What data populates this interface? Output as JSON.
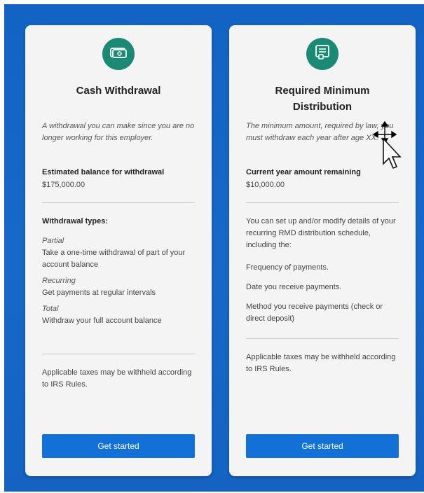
{
  "cards": [
    {
      "icon": "cash-icon",
      "title": "Cash Withdrawal",
      "description": "A withdrawal you can make since you are no longer working for this employer.",
      "amount_label": "Estimated balance for withdrawal",
      "amount_value": "$175,000.00",
      "section_title": "Withdrawal types:",
      "types": [
        {
          "name": "Partial",
          "desc": "Take a one-time withdrawal of part of your account balance"
        },
        {
          "name": "Recurring",
          "desc": "Get payments at regular intervals"
        },
        {
          "name": "Total",
          "desc": "Withdraw your full account balance"
        }
      ],
      "note": "Applicable taxes may be withheld according to IRS Rules.",
      "button": "Get started"
    },
    {
      "icon": "document-icon",
      "title_line1": "Required Minimum",
      "title_line2": "Distribution",
      "description": "The minimum amount, required by law, you must withdraw each year after age XX.",
      "amount_label": "Current year amount remaining",
      "amount_value": "$10,000.00",
      "intro": "You can set up and/or modify details of your recurring RMD distribution schedule, including the:",
      "items": [
        "Frequency of payments.",
        "Date you receive payments.",
        "Method you receive payments (check or direct deposit)"
      ],
      "note": "Applicable taxes may be withheld according to IRS Rules.",
      "button": "Get started"
    }
  ],
  "colors": {
    "background": "#1565c0",
    "card": "#f4f4f4",
    "icon_badge": "#1b8a75",
    "button": "#1270d6"
  }
}
